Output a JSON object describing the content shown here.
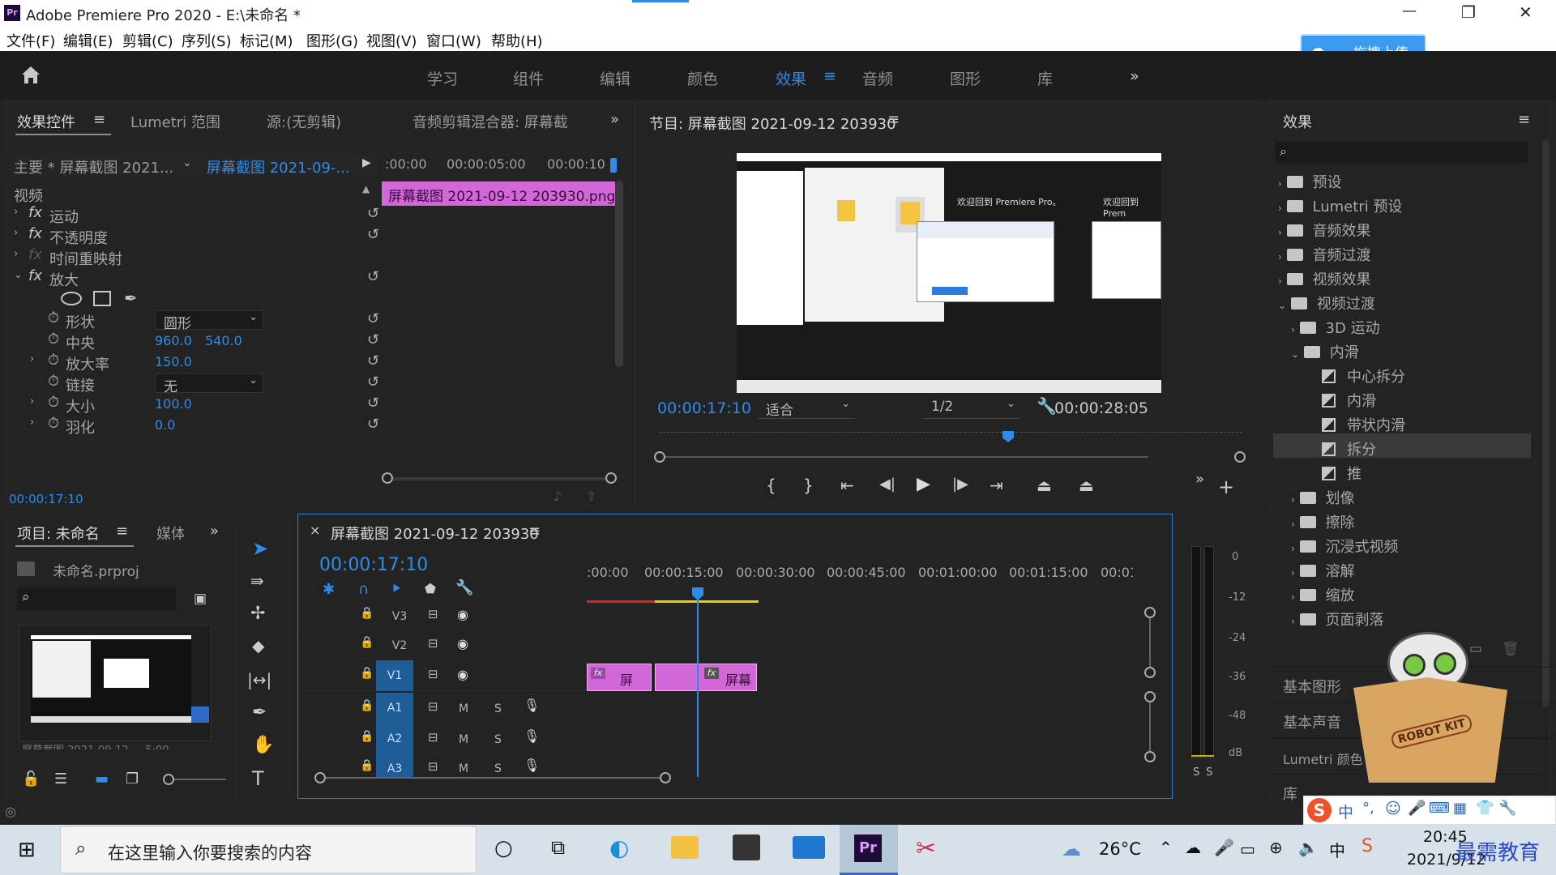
{
  "app": {
    "logo": "Pr",
    "title": "Adobe Premiere Pro 2020 - E:\\未命名 *"
  },
  "window_controls": {
    "minimize": "—",
    "restore": "❐",
    "close": "✕"
  },
  "menu": [
    "文件(F)",
    "编辑(E)",
    "剪辑(C)",
    "序列(S)",
    "标记(M)",
    "图形(G)",
    "视图(V)",
    "窗口(W)",
    "帮助(H)"
  ],
  "workspaces": [
    "学习",
    "组件",
    "编辑",
    "颜色",
    "效果",
    "音频",
    "图形",
    "库"
  ],
  "workspace_active": "效果",
  "workspace_more": "»",
  "upload_button": "拖拽上传",
  "effect_controls": {
    "tabs": [
      "效果控件",
      "Lumetri 范围",
      "源:(无剪辑)",
      "音频剪辑混合器: 屏幕截"
    ],
    "master": "主要 * 屏幕截图 2021...",
    "clip": "屏幕截图 2021-09-...",
    "ruler": [
      ":00:00",
      "00:00:05:00",
      "00:00:10"
    ],
    "clip_bar": "屏幕截图 2021-09-12 203930.png",
    "section": "视频",
    "rows": [
      {
        "name": "运动"
      },
      {
        "name": "不透明度"
      },
      {
        "name": "时间重映射"
      },
      {
        "name": "放大"
      }
    ],
    "params": {
      "shape_label": "形状",
      "shape_value": "圆形",
      "center_label": "中央",
      "center_x": "960.0",
      "center_y": "540.0",
      "mag_label": "放大率",
      "mag_value": "150.0",
      "link_label": "链接",
      "link_value": "无",
      "size_label": "大小",
      "size_value": "100.0",
      "feather_label": "羽化",
      "feather_value": "0.0"
    },
    "timecode": "00:00:17:10"
  },
  "program": {
    "title": "节目: 屏幕截图 2021-09-12 203930",
    "timecode": "00:00:17:10",
    "fit": "适合",
    "resolution": "1/2",
    "duration": "00:00:28:05",
    "welcome1": "欢迎回到 Premiere Pro。",
    "welcome2": "欢迎回到 Prem"
  },
  "project": {
    "tabs": [
      "项目: 未命名",
      "媒体"
    ],
    "file": "未命名.prproj",
    "thumb_caption": "屏幕截图 2021-09-12 ... 5:00"
  },
  "timeline": {
    "title": "屏幕截图 2021-09-12 203930",
    "timecode": "00:00:17:10",
    "ruler": [
      ":00:00",
      "00:00:15:00",
      "00:00:30:00",
      "00:00:45:00",
      "00:01:00:00",
      "00:01:15:00",
      "00:01:3"
    ],
    "tracks": [
      "V3",
      "V2",
      "V1",
      "A1",
      "A2",
      "A3"
    ],
    "m": "M",
    "s": "S",
    "clip1": "屏",
    "clip2": "屏幕"
  },
  "meter": {
    "labels": [
      "0",
      "-12",
      "-24",
      "-36",
      "-48",
      "dB"
    ],
    "solo": "S"
  },
  "effects": {
    "title": "效果",
    "items": [
      "预设",
      "Lumetri 预设",
      "音频效果",
      "音频过渡",
      "视频效果",
      "视频过渡",
      "3D 运动",
      "内滑",
      "中心拆分",
      "内滑",
      "带状内滑",
      "拆分",
      "推",
      "划像",
      "擦除",
      "沉浸式视频",
      "溶解",
      "缩放",
      "页面剥落"
    ],
    "bottom": [
      "基本图形",
      "基本声音",
      "Lumetri 颜色",
      "库"
    ]
  },
  "robot": "ROBOT KIT",
  "taskbar": {
    "search": "在这里输入你要搜索的内容",
    "temp": "26°C",
    "time": "20:45",
    "date": "2021/9/12",
    "ime": "中",
    "watermark": "最需教育"
  }
}
